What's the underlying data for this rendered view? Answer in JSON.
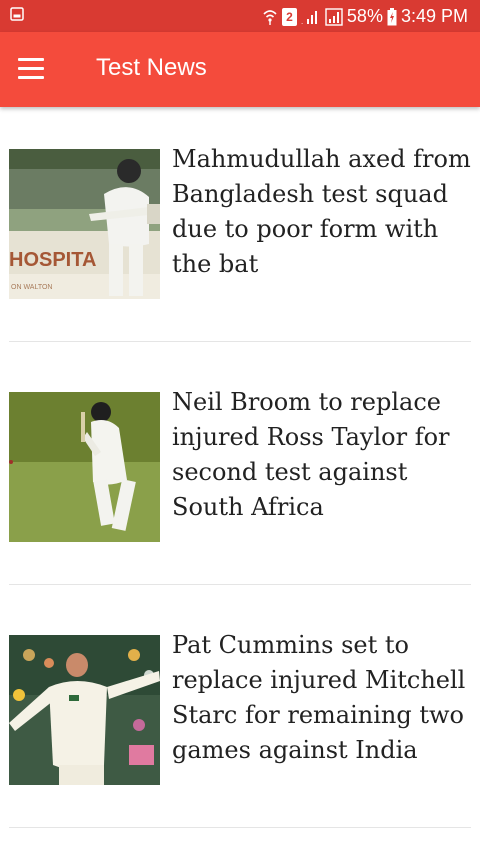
{
  "status_bar": {
    "network_badge": "2",
    "battery": "58%",
    "time": "3:49 PM",
    "background": "#d93a32"
  },
  "app_bar": {
    "title": "Test News",
    "color": "#f44b3c",
    "menu_icon": "hamburger-menu-icon"
  },
  "articles": [
    {
      "headline": "Mahmudullah axed from Bangladesh test squad due to poor form with the bat",
      "thumbnail_text": "HOSPITA",
      "thumbnail_subtext": "ON WALTON"
    },
    {
      "headline": "Neil Broom to replace injured Ross Taylor for second test against South Africa"
    },
    {
      "headline": "Pat Cummins set to replace injured Mitchell Starc for remaining two games against India"
    }
  ]
}
